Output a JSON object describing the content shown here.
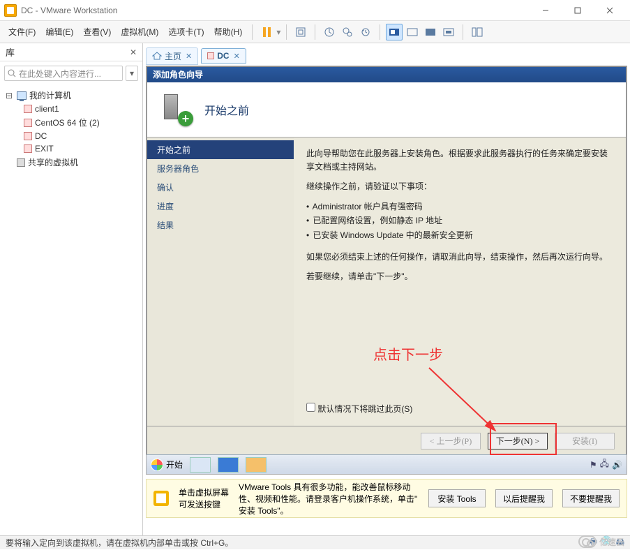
{
  "window": {
    "title": "DC - VMware Workstation"
  },
  "menu": {
    "file": "文件(F)",
    "edit": "编辑(E)",
    "view": "查看(V)",
    "vm": "虚拟机(M)",
    "tabs": "选项卡(T)",
    "help": "帮助(H)"
  },
  "sidebar": {
    "title": "库",
    "search_placeholder": "在此处键入内容进行...",
    "root": "我的计算机",
    "items": [
      "client1",
      "CentOS 64 位 (2)",
      "DC",
      "EXIT"
    ],
    "shared": "共享的虚拟机"
  },
  "tabs": {
    "home": "主页",
    "dc": "DC"
  },
  "wizard": {
    "title": "添加角色向导",
    "banner": "开始之前",
    "nav": {
      "before": "开始之前",
      "roles": "服务器角色",
      "confirm": "确认",
      "progress": "进度",
      "results": "结果"
    },
    "intro": "此向导帮助您在此服务器上安装角色。根据要求此服务器执行的任务来确定要安装享文档或主持网站。",
    "verify": "继续操作之前，请验证以下事项：",
    "bul1": "Administrator 帐户具有强密码",
    "bul2": "已配置网络设置，例如静态 IP 地址",
    "bul3": "已安装 Windows Update 中的最新安全更新",
    "cancel_note": "如果您必须结束上述的任何操作，请取消此向导，结束操作，然后再次运行向导。",
    "continue_note": "若要继续，请单击\"下一步\"。",
    "skip": "默认情况下将跳过此页(S)",
    "prev": "< 上一步(P)",
    "next": "下一步(N) >",
    "install": "安装(I)"
  },
  "taskbar": {
    "start": "开始"
  },
  "infobar": {
    "tip_title": "单击虚拟屏幕",
    "tip_sub": "可发送按键",
    "desc1": "VMware Tools 具有很多功能，能改善鼠标移动",
    "desc2": "性、视频和性能。请登录客户机操作系统，单击\"",
    "desc3": "安装 Tools\"。",
    "btn_install": "安装 Tools",
    "btn_later": "以后提醒我",
    "btn_never": "不要提醒我"
  },
  "status": {
    "text": "要将输入定向到该虚拟机，请在虚拟机内部单击或按 Ctrl+G。"
  },
  "annotation": {
    "text": "点击下一步"
  },
  "watermark": {
    "text": "亿速云"
  }
}
